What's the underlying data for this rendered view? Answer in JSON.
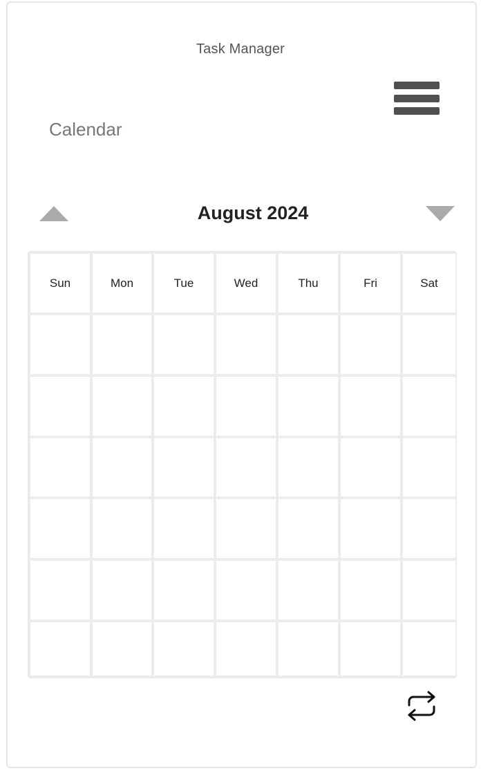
{
  "app": {
    "title": "Task Manager"
  },
  "header": {
    "section_title": "Calendar",
    "menu_icon": "hamburger-menu-icon"
  },
  "calendar": {
    "month_label": "August 2024",
    "prev_icon": "triangle-up-icon",
    "next_icon": "triangle-down-icon",
    "weekdays": [
      "Sun",
      "Mon",
      "Tue",
      "Wed",
      "Thu",
      "Fri",
      "Sat"
    ],
    "week_rows": 6
  },
  "footer": {
    "action_icon": "repeat-icon"
  },
  "colors": {
    "menu_icon": "#505050",
    "nav_arrow": "#aaaaaa",
    "grid_line": "#ececec",
    "section_title": "#777777",
    "month_label": "#222222"
  }
}
